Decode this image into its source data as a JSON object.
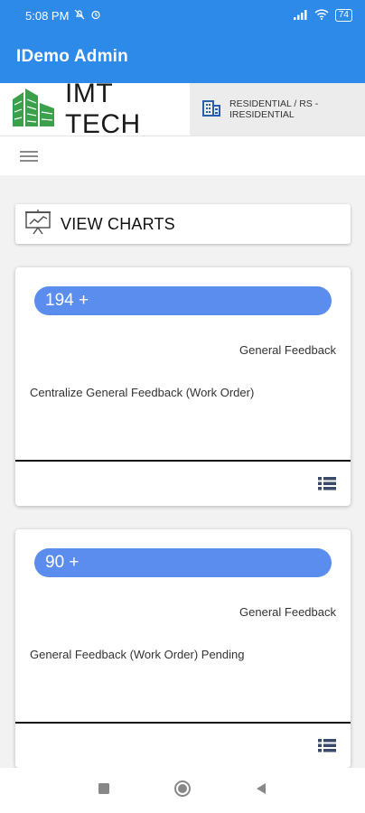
{
  "status_bar": {
    "time": "5:08 PM",
    "battery": "74"
  },
  "app_bar": {
    "title": "IDemo Admin"
  },
  "brand": {
    "name": "IMT TECH",
    "property_line1": "RESIDENTIAL / RS -",
    "property_line2": "IRESIDENTIAL"
  },
  "view_charts": {
    "label": "VIEW CHARTS"
  },
  "cards": [
    {
      "count": "194 +",
      "category": "General Feedback",
      "description": "Centralize General Feedback (Work Order)"
    },
    {
      "count": "90 +",
      "category": "General Feedback",
      "description": "General Feedback (Work Order) Pending"
    }
  ],
  "colors": {
    "primary": "#2d8ae9",
    "pill": "#5a8dee",
    "logo_green": "#3aa14a",
    "building_blue": "#2a5db0"
  }
}
